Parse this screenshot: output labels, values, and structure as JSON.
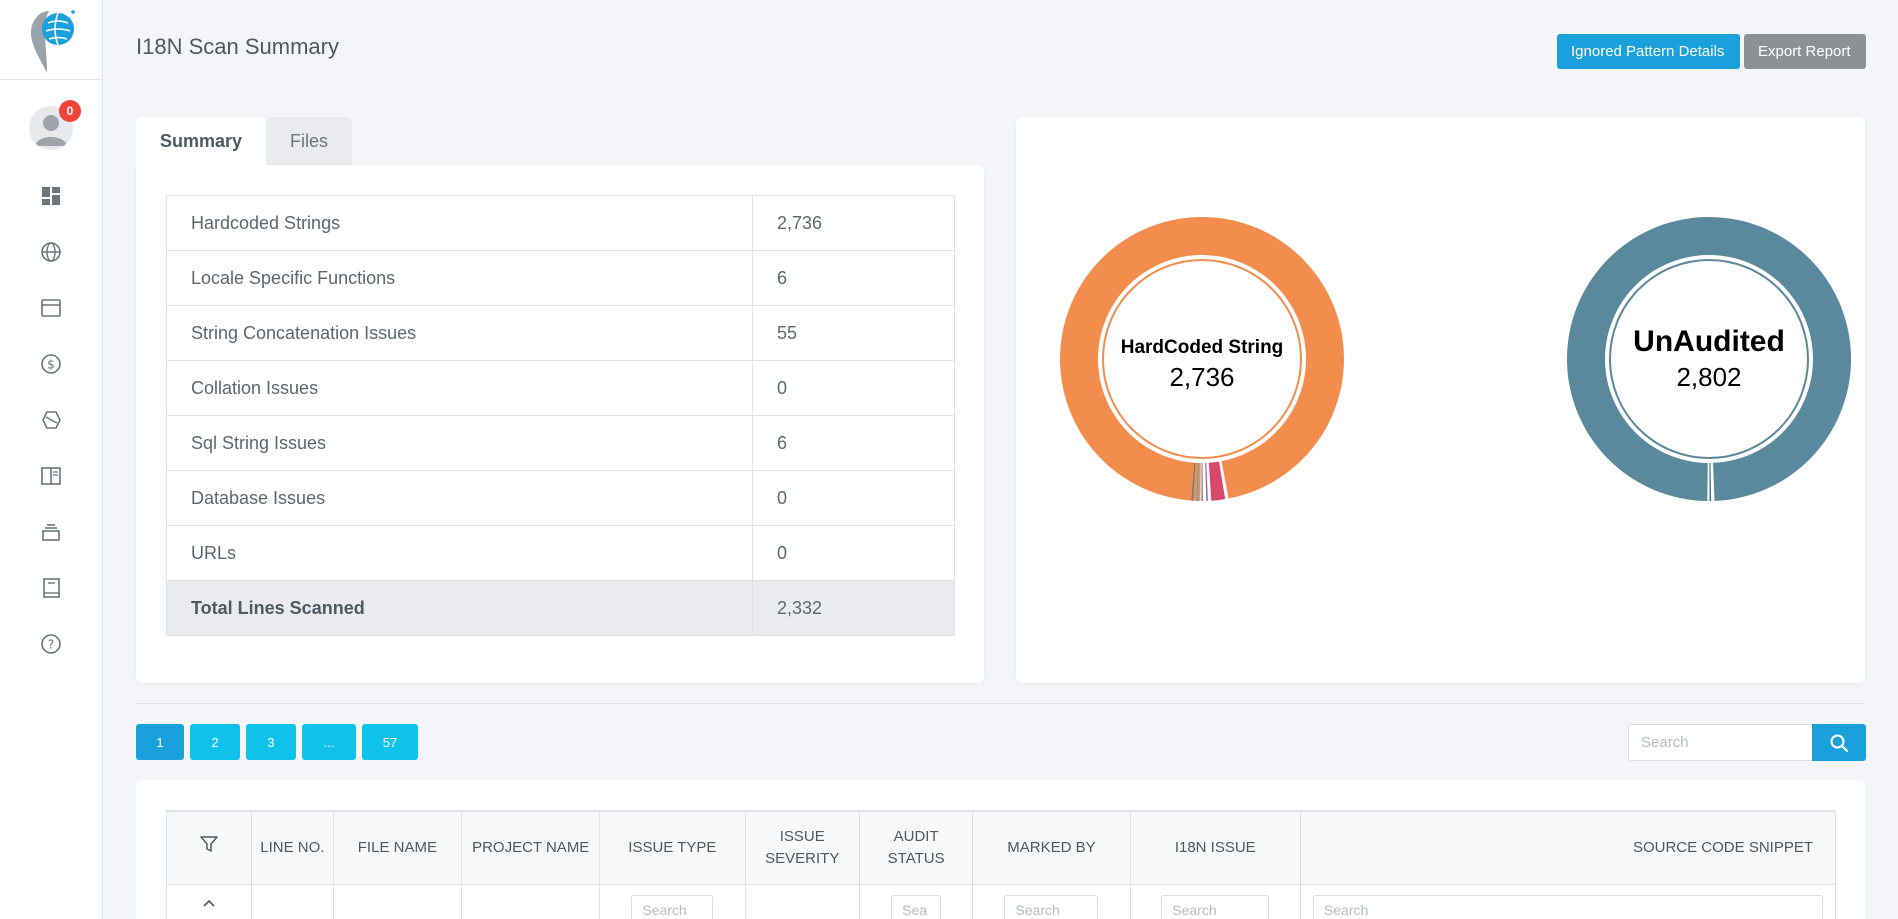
{
  "app": {
    "page_title": "I18N Scan Summary",
    "notification_count": "0"
  },
  "header": {
    "ignored_button": "Ignored Pattern Details",
    "export_button": "Export Report"
  },
  "sidebar": {
    "items": [
      {
        "icon": "dashboard-icon"
      },
      {
        "icon": "globe-icon"
      },
      {
        "icon": "window-icon"
      },
      {
        "icon": "dollar-icon"
      },
      {
        "icon": "hexagon-icon"
      },
      {
        "icon": "book-open-icon"
      },
      {
        "icon": "stack-icon"
      },
      {
        "icon": "book-icon"
      },
      {
        "icon": "help-icon"
      }
    ]
  },
  "tabs": {
    "summary": "Summary",
    "files": "Files"
  },
  "summary": {
    "rows": [
      {
        "label": "Hardcoded Strings",
        "value": "2,736"
      },
      {
        "label": "Locale Specific Functions",
        "value": "6"
      },
      {
        "label": "String Concatenation Issues",
        "value": "55"
      },
      {
        "label": "Collation Issues",
        "value": "0"
      },
      {
        "label": "Sql String Issues",
        "value": "6"
      },
      {
        "label": "Database Issues",
        "value": "0"
      },
      {
        "label": "URLs",
        "value": "0"
      }
    ],
    "total": {
      "label": "Total Lines Scanned",
      "value": "2,332"
    }
  },
  "charts": {
    "left": {
      "label": "HardCoded String",
      "value": "2,736",
      "segments": [
        {
          "value": 2736,
          "color": "#f28d4d"
        },
        {
          "value": 55,
          "color": "#d9486a"
        },
        {
          "value": 6,
          "color": "#a05fb8"
        },
        {
          "value": 6,
          "color": "#8a8a8a"
        },
        {
          "value": 6,
          "color": "#4fb0c6"
        },
        {
          "value": 6,
          "color": "#6c7a89"
        }
      ]
    },
    "right": {
      "label": "UnAudited",
      "value": "2,802",
      "segments": [
        {
          "value": 2802,
          "color": "#5a889c"
        },
        {
          "value": 12,
          "color": "#3a6fa0"
        }
      ]
    }
  },
  "pagination": {
    "pages": [
      "1",
      "2",
      "3",
      "...",
      "57"
    ],
    "active": "1"
  },
  "search": {
    "placeholder": "Search"
  },
  "issues_table": {
    "headers": [
      "LINE NO.",
      "FILE NAME",
      "PROJECT NAME",
      "ISSUE TYPE",
      "ISSUE SEVERITY",
      "AUDIT STATUS",
      "MARKED BY",
      "I18N ISSUE",
      "SOURCE CODE SNIPPET"
    ],
    "filters": {
      "issue_type": "Search",
      "audit_status": "Sea",
      "marked_by": "Search",
      "i18n_issue": "Search",
      "snippet": "Search"
    }
  }
}
